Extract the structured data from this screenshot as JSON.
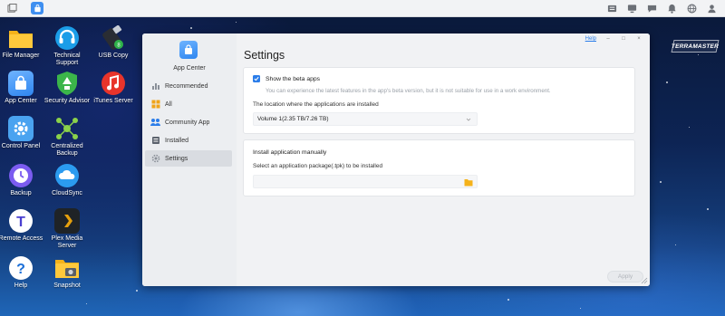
{
  "taskbar": {
    "left_icons": [
      "window-icon",
      "app-center-icon"
    ],
    "right_icons": [
      "storage-icon",
      "monitor-icon",
      "chat-icon",
      "bell-icon",
      "globe-icon",
      "user-icon"
    ]
  },
  "desktop": {
    "icons": [
      {
        "label": "File Manager",
        "icon": "folder-icon"
      },
      {
        "label": "Technical Support",
        "icon": "headset-icon"
      },
      {
        "label": "USB Copy",
        "icon": "usb-icon"
      },
      {
        "label": "App Center",
        "icon": "shopping-bag-icon"
      },
      {
        "label": "Security Advisor",
        "icon": "shield-icon"
      },
      {
        "label": "iTunes Server",
        "icon": "music-icon"
      },
      {
        "label": "Control Panel",
        "icon": "gear-icon"
      },
      {
        "label": "Centralized Backup",
        "icon": "network-icon"
      },
      {
        "label": "Backup",
        "icon": "clock-icon"
      },
      {
        "label": "CloudSync",
        "icon": "cloud-icon"
      },
      {
        "label": "Remote Access",
        "icon": "remote-icon"
      },
      {
        "label": "Plex Media Server",
        "icon": "plex-icon"
      },
      {
        "label": "Help",
        "icon": "help-icon"
      },
      {
        "label": "Snapshot",
        "icon": "camera-icon"
      }
    ],
    "brand": "TERRAMASTER"
  },
  "window": {
    "app_title": "App Center",
    "controls": {
      "help": "Help",
      "minimize": "–",
      "maximize": "□",
      "close": "×"
    },
    "sidebar": [
      {
        "label": "Recommended",
        "icon": "chart-icon"
      },
      {
        "label": "All",
        "icon": "grid-icon"
      },
      {
        "label": "Community App",
        "icon": "people-icon"
      },
      {
        "label": "Installed",
        "icon": "installed-icon"
      },
      {
        "label": "Settings",
        "icon": "settings-icon",
        "active": true
      }
    ],
    "page_title": "Settings",
    "beta": {
      "checked": true,
      "label": "Show the beta apps",
      "hint": "You can experience the latest features in the app's beta version, but it is not suitable for use in a work environment."
    },
    "location": {
      "label": "The location where the applications are installed",
      "value": "Volume 1(2.35 TB/7.26 TB)"
    },
    "manual": {
      "title": "Install application manually",
      "subtitle": "Select an application package(.tpk) to be installed",
      "value": ""
    },
    "apply_label": "Apply"
  },
  "colors": {
    "accent": "#2b7de9",
    "window_bg": "#f1f2f4",
    "card_bg": "#ffffff"
  }
}
